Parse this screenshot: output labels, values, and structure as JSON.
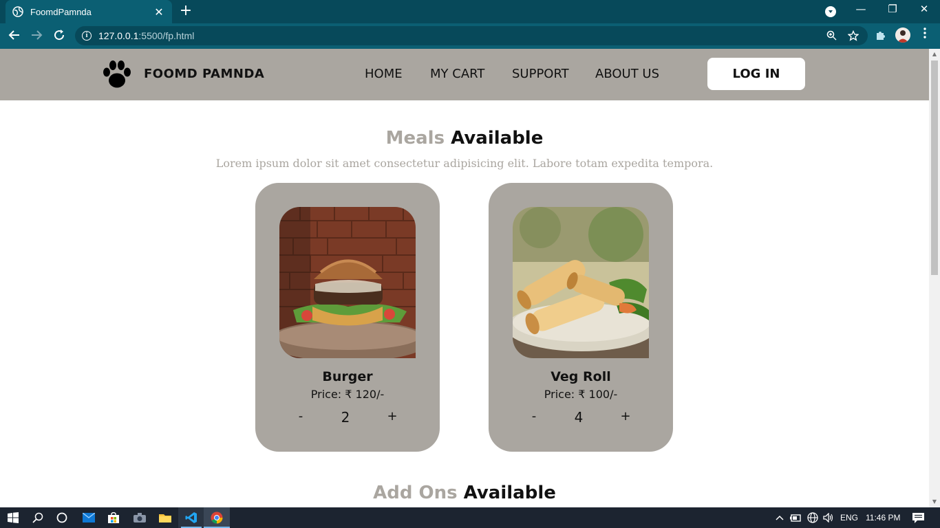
{
  "browser": {
    "tab_title": "FoomdPamnda",
    "new_tab": "+",
    "close_tab": "✕",
    "url_host": "127.0.0.1",
    "url_path": ":5500/fp.html",
    "window_controls": {
      "minimize": "—",
      "maximize": "❐",
      "close": "✕"
    }
  },
  "site": {
    "brand": "FOOMD PAMNDA",
    "nav": [
      "HOME",
      "MY CART",
      "SUPPORT",
      "ABOUT US"
    ],
    "login": "LOG IN"
  },
  "meals": {
    "title_muted": "Meals",
    "title_dark": "Available",
    "subtitle": "Lorem ipsum dolor sit amet consectetur adipisicing elit. Labore totam expedita tempora.",
    "items": [
      {
        "name": "Burger",
        "price": "Price: ₹ 120/-",
        "minus": "-",
        "qty": "2",
        "plus": "+"
      },
      {
        "name": "Veg Roll",
        "price": "Price: ₹ 100/-",
        "minus": "-",
        "qty": "4",
        "plus": "+"
      }
    ]
  },
  "addons": {
    "title_muted": "Add Ons",
    "title_dark": "Available"
  },
  "taskbar": {
    "language": "ENG",
    "time": "11:46 PM"
  },
  "colors": {
    "chrome_dark": "#07495a",
    "chrome_toolbar": "#0b5f73",
    "site_accent": "#aaa6a0",
    "taskbar": "#1c2430"
  }
}
